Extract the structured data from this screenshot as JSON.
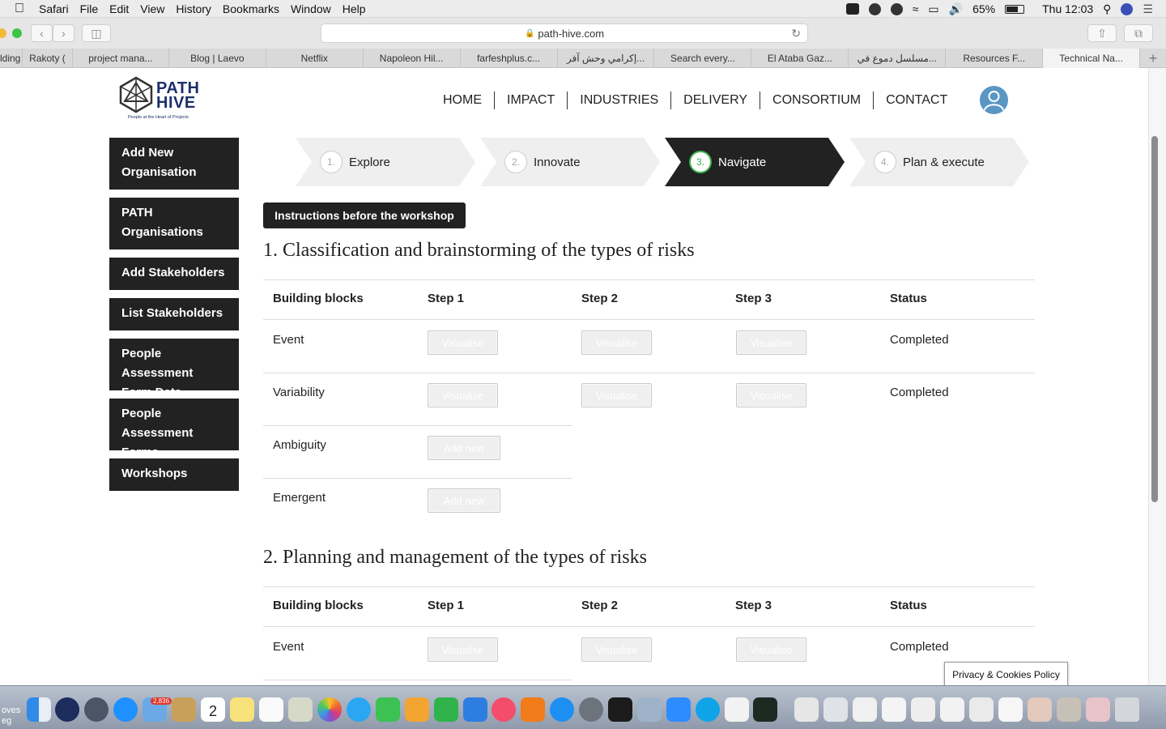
{
  "menubar": {
    "app": "Safari",
    "items": [
      "File",
      "Edit",
      "View",
      "History",
      "Bookmarks",
      "Window",
      "Help"
    ],
    "battery": "65%",
    "clock": "Thu 12:03"
  },
  "browser": {
    "url": "path-hive.com",
    "tabs": [
      "lding",
      "Rakoty (",
      "project mana...",
      "Blog | Laevo",
      "Netflix",
      "Napoleon Hil...",
      "farfeshplus.c...",
      "إكرامي وحش آفر...",
      "Search every...",
      "El Ataba Gaz...",
      "مسلسل دموع في...",
      "Resources F...",
      "Technical Na..."
    ],
    "active_tab": "Technical Na..."
  },
  "site": {
    "logo_line1": "PATH",
    "logo_line2": "HIVE",
    "logo_tagline": "People at the Heart of Projects",
    "nav": [
      "HOME",
      "IMPACT",
      "INDUSTRIES",
      "DELIVERY",
      "CONSORTIUM",
      "CONTACT"
    ]
  },
  "sidebar": [
    "Add New Organisation",
    "PATH Organisations",
    "Add Stakeholders",
    "List Stakeholders",
    "People Assessment Form Data",
    "People Assessment Forms",
    "Workshops"
  ],
  "steps": [
    {
      "num": "1.",
      "label": "Explore"
    },
    {
      "num": "2.",
      "label": "Innovate"
    },
    {
      "num": "3.",
      "label": "Navigate"
    },
    {
      "num": "4.",
      "label": "Plan & execute"
    }
  ],
  "active_step": "Navigate",
  "instructions_button": "Instructions before the workshop",
  "sections": [
    {
      "title": "1. Classification and brainstorming of the types of risks",
      "headers": [
        "Building blocks",
        "Step 1",
        "Step 2",
        "Step 3",
        "Status"
      ],
      "rows": [
        {
          "block": "Event",
          "step1": "Visualise",
          "step2": "Visualise",
          "step3": "Visualise",
          "status": "Completed"
        },
        {
          "block": "Variability",
          "step1": "Visualise",
          "step2": "Visualise",
          "step3": "Visualise",
          "status": "Completed"
        },
        {
          "block": "Ambiguity",
          "step1": "Add new"
        },
        {
          "block": "Emergent",
          "step1": "Add new"
        }
      ]
    },
    {
      "title": "2. Planning and management of the types of risks",
      "headers": [
        "Building blocks",
        "Step 1",
        "Step 2",
        "Step 3",
        "Status"
      ],
      "rows": [
        {
          "block": "Event",
          "step1": "Visualise",
          "step2": "Visualise",
          "step3": "Visualise",
          "status": "Completed"
        }
      ]
    }
  ],
  "privacy_label": "Privacy & Cookies Policy",
  "dock": {
    "edge_text": "oves eg",
    "badge_mail": "2,836",
    "calendar_day": "2"
  },
  "colors": {
    "dark": "#222222",
    "step_inactive": "#efefef",
    "accent_green": "#3ab34a",
    "brand_navy": "#1c2f6b"
  }
}
